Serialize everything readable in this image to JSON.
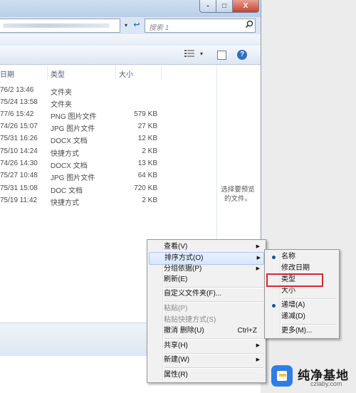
{
  "window": {
    "caption_buttons": {
      "min": "-",
      "max": "□",
      "close": "X"
    },
    "search_placeholder": "搜索 1",
    "address_dropdown": "▾",
    "address_go": "↩"
  },
  "toolbar": {
    "view_icon": "view-details-icon",
    "view_dropdown": "▾",
    "help": "?"
  },
  "columns": {
    "date": "日期",
    "type": "类型",
    "size": "大小"
  },
  "files": [
    {
      "date": "76/2 13:46",
      "type": "文件夹",
      "size": ""
    },
    {
      "date": "75/24 13:58",
      "type": "文件夹",
      "size": ""
    },
    {
      "date": "77/6 15:42",
      "type": "PNG 图片文件",
      "size": "579 KB"
    },
    {
      "date": "74/26 15:07",
      "type": "JPG 图片文件",
      "size": "27 KB"
    },
    {
      "date": "75/31 16:26",
      "type": "DOCX 文档",
      "size": "12 KB"
    },
    {
      "date": "75/10 14:24",
      "type": "快捷方式",
      "size": "2 KB"
    },
    {
      "date": "74/26 14:30",
      "type": "DOCX 文档",
      "size": "13 KB"
    },
    {
      "date": "75/27 10:48",
      "type": "JPG 图片文件",
      "size": "64 KB"
    },
    {
      "date": "75/31 15:08",
      "type": "DOC 文档",
      "size": "720 KB"
    },
    {
      "date": "75/19 11:42",
      "type": "快捷方式",
      "size": "2 KB"
    }
  ],
  "preview_pane": {
    "line1": "选择要预览",
    "line2": "的文件。"
  },
  "context_menu": {
    "view": "查看(V)",
    "sort_by": "排序方式(O)",
    "group_by": "分组依据(P)",
    "refresh": "刷新(E)",
    "customize_folder": "自定义文件夹(F)...",
    "paste": "粘贴(P)",
    "paste_shortcut": "粘贴快捷方式(S)",
    "undo_delete": "撤消 删除(U)",
    "undo_shortcut": "Ctrl+Z",
    "share": "共享(H)",
    "new": "新建(W)",
    "properties": "属性(R)",
    "arrow": "▶"
  },
  "sort_submenu": {
    "name": "名称",
    "date_modified": "修改日期",
    "type": "类型",
    "size": "大小",
    "ascending": "递增(A)",
    "descending": "递减(D)",
    "more": "更多(M)..."
  },
  "watermark": {
    "title": "纯净基地",
    "url": "czlaby.com"
  },
  "colors": {
    "highlight_box": "#d9282f",
    "menu_bg": "#f1f1f1",
    "bullet": "#1b4fa8"
  }
}
